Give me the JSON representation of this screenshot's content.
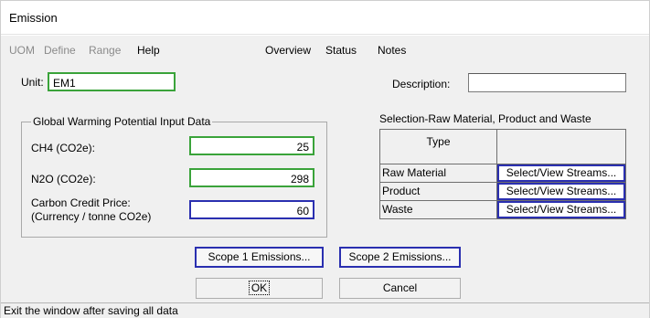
{
  "window": {
    "title": "Emission"
  },
  "menu": {
    "items": [
      {
        "label": "UOM",
        "enabled": false
      },
      {
        "label": "Define",
        "enabled": false
      },
      {
        "label": "Range",
        "enabled": false
      },
      {
        "label": "Help",
        "enabled": true
      },
      {
        "label": "Overview",
        "enabled": true
      },
      {
        "label": "Status",
        "enabled": true
      },
      {
        "label": "Notes",
        "enabled": true
      }
    ]
  },
  "form": {
    "unit_label": "Unit:",
    "unit_value": "EM1",
    "description_label": "Description:",
    "description_value": ""
  },
  "gwp": {
    "legend": "Global Warming Potential Input Data",
    "ch4_label": "CH4 (CO2e):",
    "ch4_value": "25",
    "n2o_label": "N2O (CO2e):",
    "n2o_value": "298",
    "carbon_label_1": "Carbon Credit Price:",
    "carbon_label_2": "(Currency / tonne CO2e)",
    "carbon_value": "60"
  },
  "selection": {
    "title": "Selection-Raw Material, Product and Waste",
    "header_type": "Type",
    "rows": [
      {
        "type": "Raw Material",
        "button": "Select/View Streams..."
      },
      {
        "type": "Product",
        "button": "Select/View Streams..."
      },
      {
        "type": "Waste",
        "button": "Select/View Streams..."
      }
    ]
  },
  "buttons": {
    "scope1": "Scope 1 Emissions...",
    "scope2": "Scope 2 Emissions...",
    "ok": "OK",
    "cancel": "Cancel"
  },
  "status": {
    "text": "Exit the window after saving all data"
  },
  "colors": {
    "green_border": "#3aa33a",
    "blue_border": "#2a2fb0",
    "client_bg": "#f0f0f0"
  }
}
